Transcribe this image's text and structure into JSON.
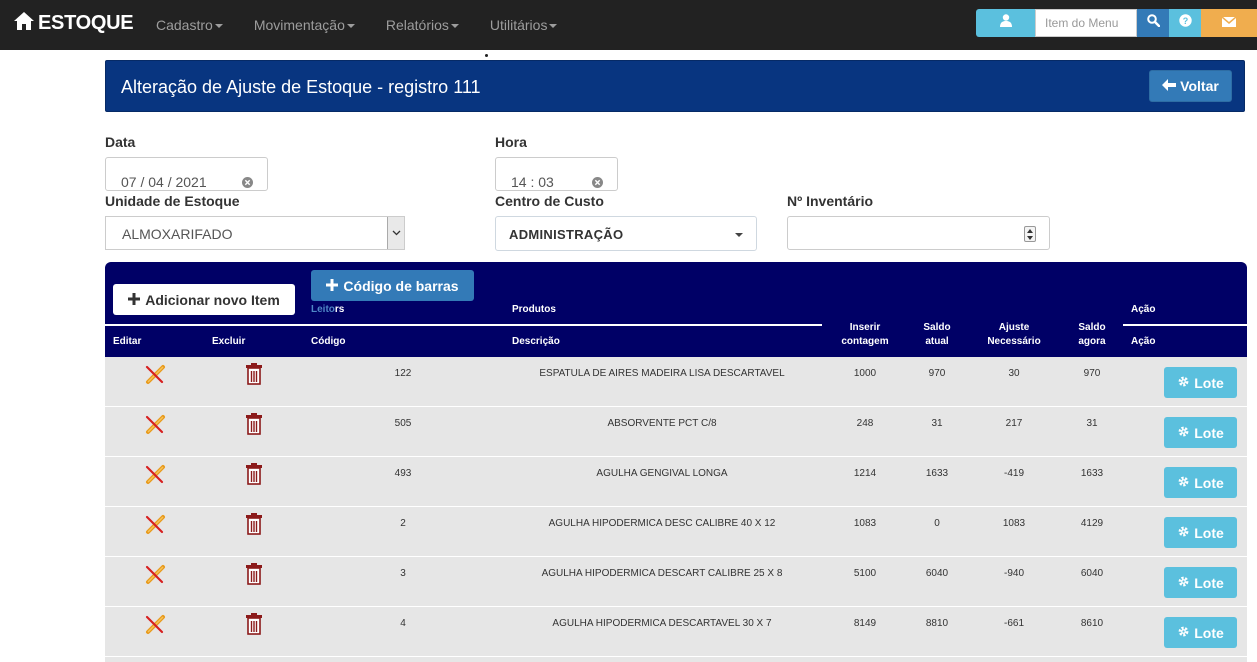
{
  "navbar": {
    "brand": "ESTOQUE",
    "menu": [
      {
        "label": "Cadastro"
      },
      {
        "label": "Movimentação"
      },
      {
        "label": "Relatórios"
      },
      {
        "label": "Utilitários"
      }
    ],
    "search_placeholder": "Item do Menu",
    "icons": [
      "home-icon",
      "user-icon",
      "search-icon",
      "help-icon",
      "mail-icon"
    ]
  },
  "panel": {
    "title": "Alteração de Ajuste de Estoque - registro 111",
    "back_label": "Voltar"
  },
  "form": {
    "date_label": "Data",
    "date_value": "07 / 04 / 2021",
    "time_label": "Hora",
    "time_value": "14 : 03",
    "unit_label": "Unidade de Estoque",
    "unit_value": "ALMOXARIFADO",
    "cost_center_label": "Centro de Custo",
    "cost_center_value": "ADMINISTRAÇÃO",
    "inventory_label": "Nº Inventário",
    "inventory_value": ""
  },
  "items": {
    "add_label": "Adicionar novo Item",
    "barcode_label": "Código de barras",
    "readers_prefix": "Leito",
    "readers_suffix": "rs",
    "group_products": "Produtos",
    "group_action": "Ação",
    "columns": {
      "edit": "Editar",
      "delete": "Excluir",
      "code": "Código",
      "description": "Descrição",
      "count_1": "Inserir",
      "count_2": "contagem",
      "saldo_atual_1": "Saldo",
      "saldo_atual_2": "atual",
      "ajuste_1": "Ajuste",
      "ajuste_2": "Necessário",
      "saldo_agora_1": "Saldo",
      "saldo_agora_2": "agora",
      "action": "Ação"
    },
    "lote_label": "Lote",
    "rows": [
      {
        "code": "122",
        "description": "ESPATULA DE AIRES MADEIRA LISA DESCARTAVEL",
        "count": "1000",
        "saldo_atual": "970",
        "ajuste": "30",
        "saldo_agora": "970"
      },
      {
        "code": "505",
        "description": "ABSORVENTE PCT C/8",
        "count": "248",
        "saldo_atual": "31",
        "ajuste": "217",
        "saldo_agora": "31"
      },
      {
        "code": "493",
        "description": "AGULHA GENGIVAL LONGA",
        "count": "1214",
        "saldo_atual": "1633",
        "ajuste": "-419",
        "saldo_agora": "1633"
      },
      {
        "code": "2",
        "description": "AGULHA HIPODERMICA DESC CALIBRE 40 X 12",
        "count": "1083",
        "saldo_atual": "0",
        "ajuste": "1083",
        "saldo_agora": "4129"
      },
      {
        "code": "3",
        "description": "AGULHA HIPODERMICA DESCART CALIBRE 25 X 8",
        "count": "5100",
        "saldo_atual": "6040",
        "ajuste": "-940",
        "saldo_agora": "6040"
      },
      {
        "code": "4",
        "description": "AGULHA HIPODERMICA DESCARTAVEL 30 X 7",
        "count": "8149",
        "saldo_atual": "8810",
        "ajuste": "-661",
        "saldo_agora": "8610"
      }
    ]
  }
}
